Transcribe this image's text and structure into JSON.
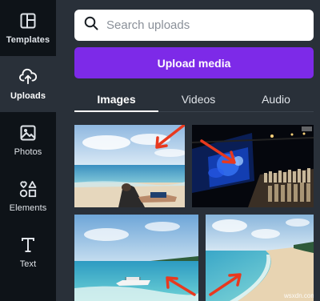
{
  "sidebar": {
    "items": [
      {
        "label": "Templates",
        "icon": "templates-icon",
        "active": false
      },
      {
        "label": "Uploads",
        "icon": "uploads-icon",
        "active": true
      },
      {
        "label": "Photos",
        "icon": "photos-icon",
        "active": false
      },
      {
        "label": "Elements",
        "icon": "elements-icon",
        "active": false
      },
      {
        "label": "Text",
        "icon": "text-icon",
        "active": false
      }
    ]
  },
  "search": {
    "placeholder": "Search uploads",
    "value": ""
  },
  "upload_button": {
    "label": "Upload media"
  },
  "tabs": [
    {
      "label": "Images",
      "active": true
    },
    {
      "label": "Videos",
      "active": false
    },
    {
      "label": "Audio",
      "active": false
    }
  ],
  "images": [
    {
      "name": "beach-person-lounging"
    },
    {
      "name": "concert-stage-night"
    },
    {
      "name": "beach-boat-turquoise"
    },
    {
      "name": "beach-shoreline-sand"
    }
  ],
  "colors": {
    "sidebar_bg": "#0e1318",
    "panel_bg": "#293039",
    "accent_purple": "#7d2ae8",
    "arrow_red": "#e8391e"
  }
}
